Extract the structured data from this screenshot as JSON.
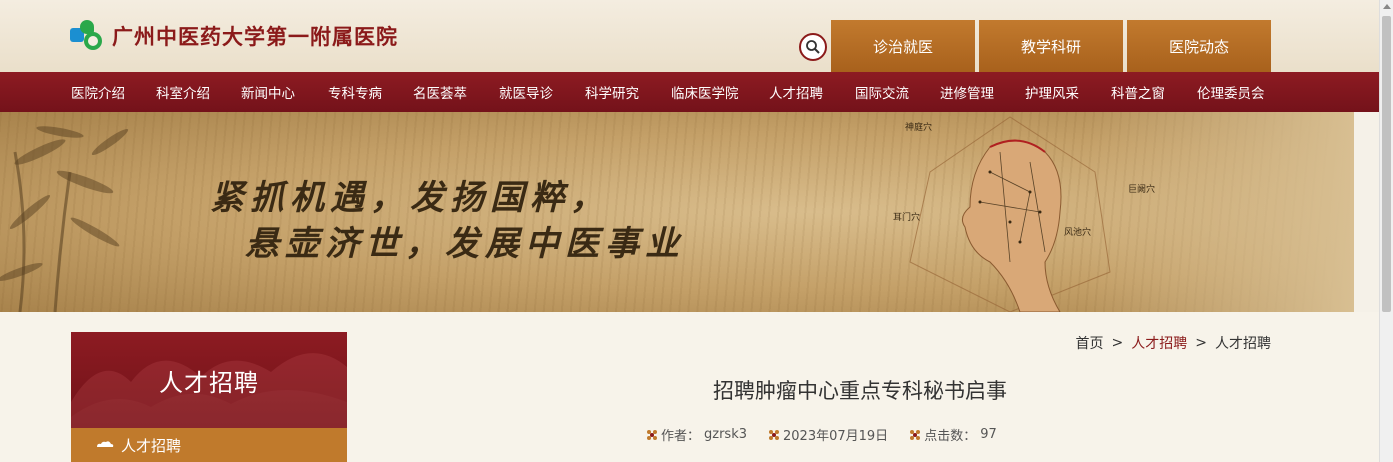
{
  "header": {
    "logo_text": "广州中医药大学第一附属医院",
    "top_tabs": [
      "诊治就医",
      "教学科研",
      "医院动态"
    ]
  },
  "nav": {
    "items": [
      "医院介绍",
      "科室介绍",
      "新闻中心",
      "专科专病",
      "名医荟萃",
      "就医导诊",
      "科学研究",
      "临床医学院",
      "人才招聘",
      "国际交流",
      "进修管理",
      "护理风采",
      "科普之窗",
      "伦理委员会"
    ]
  },
  "banner": {
    "slogan_line1": "紧抓机遇，发扬国粹，",
    "slogan_line2": "悬壶济世，发展中医事业",
    "acupoint_labels": [
      "神庭穴",
      "巨阙穴",
      "耳门穴",
      "风池穴"
    ]
  },
  "sidebar": {
    "title": "人才招聘",
    "items": [
      "人才招聘"
    ]
  },
  "breadcrumb": {
    "items": [
      "首页",
      "人才招聘",
      "人才招聘"
    ],
    "separator": ">"
  },
  "article": {
    "title": "招聘肿瘤中心重点专科秘书启事",
    "author_label": "作者：",
    "author": "gzrsk3",
    "date": "2023年07月19日",
    "clicks_label": "点击数：",
    "clicks": "97"
  },
  "colors": {
    "primary_red": "#8d1b22",
    "accent_orange": "#c07a2c",
    "background": "#f5f1e8"
  }
}
